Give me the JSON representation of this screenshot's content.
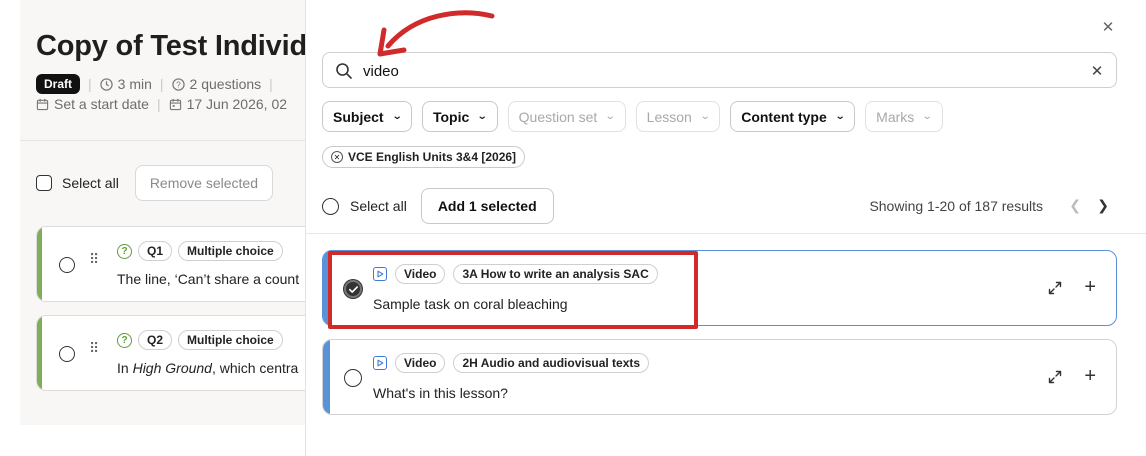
{
  "background_page": {
    "title": "Copy of Test Individ",
    "draft_badge": "Draft",
    "duration": "3 min",
    "questions": "2 questions",
    "start_date": "Set a start date",
    "due_date": "17 Jun 2026, 02",
    "select_all": "Select all",
    "remove_selected": "Remove selected",
    "questions_list": [
      {
        "number": "Q1",
        "type": "Multiple choice",
        "text": "The line, ‘Can’t share a count"
      },
      {
        "number": "Q2",
        "type": "Multiple choice",
        "text_pre": "In ",
        "text_em": "High Ground",
        "text_post": ", which centra"
      }
    ]
  },
  "panel": {
    "search": {
      "value": "video",
      "placeholder": "Search"
    },
    "filters": [
      {
        "label": "Subject",
        "enabled": true
      },
      {
        "label": "Topic",
        "enabled": true
      },
      {
        "label": "Question set",
        "enabled": false
      },
      {
        "label": "Lesson",
        "enabled": false
      },
      {
        "label": "Content type",
        "enabled": true
      },
      {
        "label": "Marks",
        "enabled": false
      }
    ],
    "active_chip": "VCE English Units 3&4 [2026]",
    "select_all": "Select all",
    "add_selected": "Add 1 selected",
    "results_text": "Showing 1-20 of 187 results",
    "items": [
      {
        "kind": "Video",
        "lesson": "3A How to write an analysis SAC",
        "title": "Sample task on coral bleaching",
        "selected": true
      },
      {
        "kind": "Video",
        "lesson": "2H Audio and audiovisual texts",
        "title": "What's in this lesson?",
        "selected": false
      }
    ]
  },
  "colors": {
    "accent_blue": "#5a92d6",
    "question_green": "#7fae5a",
    "annotation_red": "#d12a2a"
  },
  "icons": [
    "close-icon",
    "search-icon",
    "clear-icon",
    "chevron-down-icon",
    "clock-icon",
    "question-icon",
    "calendar-icon",
    "video-icon",
    "expand-icon",
    "plus-icon",
    "drag-handle-icon"
  ]
}
